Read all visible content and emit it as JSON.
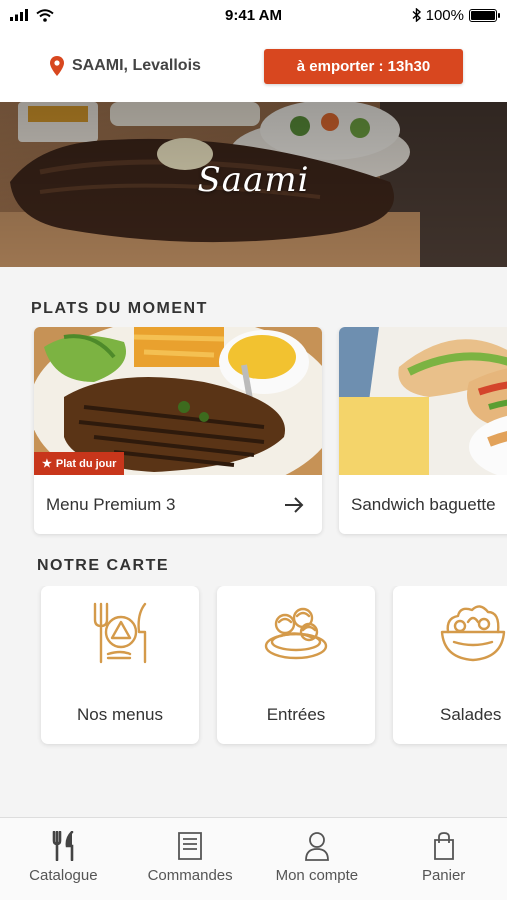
{
  "status_bar": {
    "time": "9:41 AM",
    "battery": "100%",
    "battery_level": 1.0
  },
  "header": {
    "location": "SAAMI, Levallois",
    "takeaway_button": "à emporter : 13h30"
  },
  "hero": {
    "logo": "Saami"
  },
  "dishes": {
    "title": "PLATS DU MOMENT",
    "items": [
      {
        "name": "Menu Premium 3",
        "badge": "Plat du jour"
      },
      {
        "name": "Sandwich baguette"
      }
    ]
  },
  "menu": {
    "title": "NOTRE CARTE",
    "categories": [
      {
        "label": "Nos menus",
        "icon": "cutlery-plate-icon"
      },
      {
        "label": "Entrées",
        "icon": "starter-platter-icon"
      },
      {
        "label": "Salades",
        "icon": "salad-bowl-icon"
      }
    ]
  },
  "tabbar": {
    "items": [
      {
        "label": "Catalogue",
        "icon": "cutlery-icon"
      },
      {
        "label": "Commandes",
        "icon": "receipt-icon"
      },
      {
        "label": "Mon compte",
        "icon": "user-icon"
      },
      {
        "label": "Panier",
        "icon": "bag-icon"
      }
    ]
  },
  "colors": {
    "accent": "#d8471f",
    "badge": "#c8361b",
    "icon_gold": "#d49a4a"
  }
}
